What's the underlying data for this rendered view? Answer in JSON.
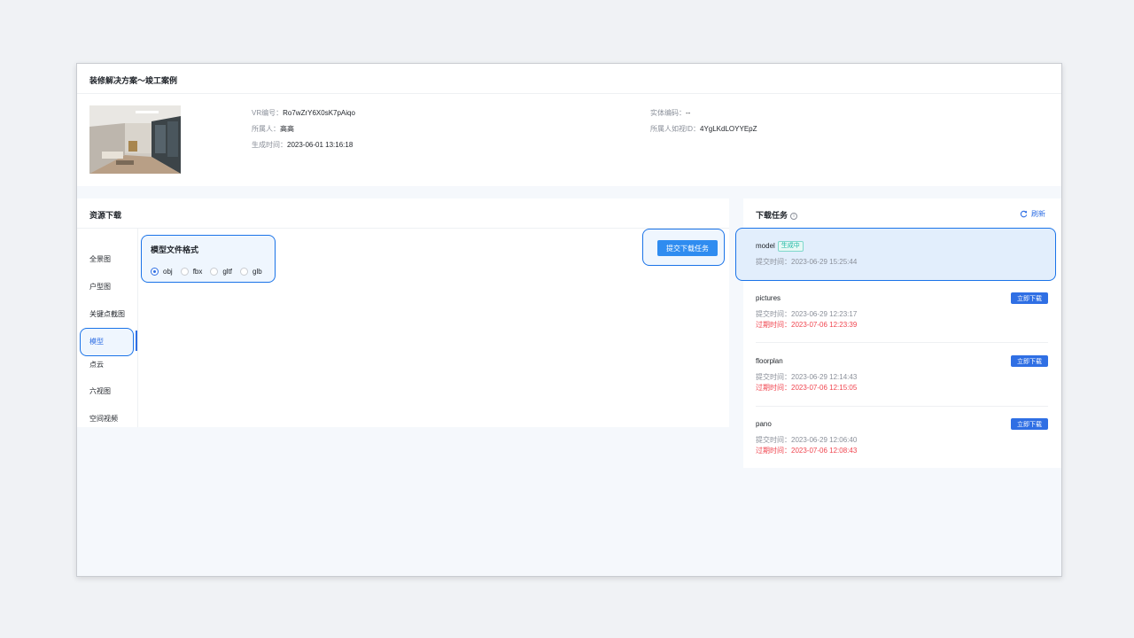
{
  "page": {
    "title": "装修解决方案～竣工案例"
  },
  "info": {
    "vr_id_label": "VR编号：",
    "vr_id": "Ro7wZrY6X0sK7pAiqo",
    "owner_label": "所属人：",
    "owner": "高高",
    "created_label": "生成时间：",
    "created": "2023-06-01 13:16:18",
    "entity_code_label": "实体编码：",
    "entity_code": "--",
    "owner_rushi_id_label": "所属人如视ID：",
    "owner_rushi_id": "4YgLKdLOYYEpZ"
  },
  "resources": {
    "title": "资源下载",
    "nav": [
      "全景图",
      "户型图",
      "关键点截图",
      "模型",
      "点云",
      "六视图",
      "空间视频"
    ],
    "active_index": 3,
    "format_title": "模型文件格式",
    "formats": [
      "obj",
      "fbx",
      "gltf",
      "glb"
    ],
    "selected_format": "obj",
    "submit_label": "提交下载任务"
  },
  "tasks": {
    "title": "下载任务",
    "info_icon": "info-icon",
    "refresh_label": "刷新",
    "submit_prefix": "提交时间：",
    "expire_prefix": "过期时间：",
    "download_label": "立即下载",
    "items": [
      {
        "name": "model",
        "status": "生成中",
        "submitted": "2023-06-29 15:25:44"
      },
      {
        "name": "pictures",
        "submitted": "2023-06-29 12:23:17",
        "expires": "2023-07-06 12:23:39"
      },
      {
        "name": "floorplan",
        "submitted": "2023-06-29 12:14:43",
        "expires": "2023-07-06 12:15:05"
      },
      {
        "name": "pano",
        "submitted": "2023-06-29 12:06:40",
        "expires": "2023-07-06 12:08:43"
      }
    ]
  },
  "colors": {
    "accent": "#2f6fe4",
    "submit_button": "#2f8cf0",
    "expire_text": "#f0454f",
    "status_badge": "#19b6a3",
    "highlight_outline": "#1a73e8"
  }
}
